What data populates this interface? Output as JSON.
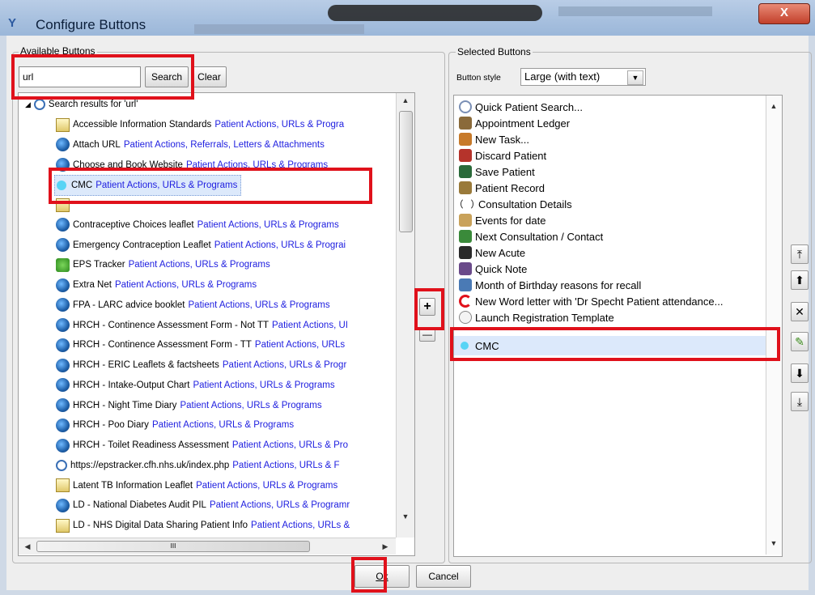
{
  "window": {
    "title": "Configure Buttons",
    "close_label": "X"
  },
  "available": {
    "group_label": "Available Buttons",
    "search_value": "url",
    "search_button": "Search",
    "clear_button": "Clear",
    "root_label": "Search results for 'url'",
    "items": [
      {
        "name": "Accessible Information Standards",
        "category": "Patient Actions, URLs & Progra",
        "icon": "document-icon"
      },
      {
        "name": "Attach URL",
        "category": "Patient Actions, Referrals, Letters & Attachments",
        "icon": "globe-icon"
      },
      {
        "name": "Choose and Book Website",
        "category": "Patient Actions, URLs & Programs",
        "icon": "globe-icon"
      },
      {
        "name": "CMC",
        "category": "Patient Actions, URLs & Programs",
        "icon": "cyan-dot-icon"
      },
      {
        "name": "",
        "category": "",
        "icon": "document-icon"
      },
      {
        "name": "Contraceptive Choices leaflet",
        "category": "Patient Actions, URLs & Programs",
        "icon": "globe-icon"
      },
      {
        "name": "Emergency Contraception Leaflet",
        "category": "Patient Actions, URLs & Prograi",
        "icon": "globe-icon"
      },
      {
        "name": "EPS Tracker",
        "category": "Patient Actions, URLs & Programs",
        "icon": "green-tree-icon"
      },
      {
        "name": "Extra Net",
        "category": "Patient Actions, URLs & Programs",
        "icon": "globe-icon"
      },
      {
        "name": "FPA - LARC advice booklet",
        "category": "Patient Actions, URLs & Programs",
        "icon": "globe-icon"
      },
      {
        "name": "HRCH - Continence Assessment Form - Not TT",
        "category": "Patient Actions, UI",
        "icon": "globe-icon"
      },
      {
        "name": "HRCH - Continence Assessment Form - TT",
        "category": "Patient Actions, URLs",
        "icon": "globe-icon"
      },
      {
        "name": "HRCH - ERIC Leaflets & factsheets",
        "category": "Patient Actions, URLs & Progr",
        "icon": "globe-icon"
      },
      {
        "name": "HRCH - Intake-Output Chart",
        "category": "Patient Actions, URLs & Programs",
        "icon": "globe-icon"
      },
      {
        "name": "HRCH - Night Time Diary",
        "category": "Patient Actions, URLs & Programs",
        "icon": "globe-icon"
      },
      {
        "name": "HRCH - Poo Diary",
        "category": "Patient Actions, URLs & Programs",
        "icon": "globe-icon"
      },
      {
        "name": "HRCH - Toilet Readiness Assessment",
        "category": "Patient Actions, URLs & Pro",
        "icon": "globe-icon"
      },
      {
        "name": "https://epstracker.cfh.nhs.uk/index.php",
        "category": "Patient Actions, URLs & F",
        "icon": "magnifier-icon"
      },
      {
        "name": "Latent TB Information Leaflet",
        "category": "Patient Actions, URLs & Programs",
        "icon": "document-icon"
      },
      {
        "name": "LD - National Diabetes Audit PIL",
        "category": "Patient Actions, URLs & Programr",
        "icon": "globe-icon"
      },
      {
        "name": "LD - NHS Digital Data Sharing Patient Info",
        "category": "Patient Actions, URLs &",
        "icon": "folder-icon"
      }
    ],
    "hscroll_grip": "III"
  },
  "transfer": {
    "add_label": "+",
    "remove_label": "—"
  },
  "selected": {
    "group_label": "Selected Buttons",
    "style_label": "Button style",
    "style_value": "Large (with text)",
    "items": [
      {
        "label": "Quick Patient Search...",
        "icon": "magnifier-icon",
        "color": "#7a8fb5"
      },
      {
        "label": "Appointment Ledger",
        "icon": "ledger-icon",
        "color": "#8a6a3a"
      },
      {
        "label": "New Task...",
        "icon": "task-icon",
        "color": "#c77a2a"
      },
      {
        "label": "Discard Patient",
        "icon": "discard-icon",
        "color": "#b5332b"
      },
      {
        "label": "Save Patient",
        "icon": "save-icon",
        "color": "#2a6a3a"
      },
      {
        "label": "Patient Record",
        "icon": "record-icon",
        "color": "#9a7a3a"
      },
      {
        "label": "Consultation Details",
        "icon": "bracket-icon",
        "color": "#ffffff"
      },
      {
        "label": "Events for date",
        "icon": "events-icon",
        "color": "#c9a25a"
      },
      {
        "label": "Next Consultation / Contact",
        "icon": "next-icon",
        "color": "#3a8a3a"
      },
      {
        "label": "New Acute",
        "icon": "acute-icon",
        "color": "#2a2a2a"
      },
      {
        "label": "Quick Note",
        "icon": "note-icon",
        "color": "#6a4a8a"
      },
      {
        "label": "Month of Birthday reasons for recall",
        "icon": "recall-icon",
        "color": "#4a7ab5"
      },
      {
        "label": "New Word letter with 'Dr Specht Patient attendance...",
        "icon": "letter-c-icon",
        "color": "#e0111b"
      },
      {
        "label": "Launch Registration Template",
        "icon": "template-icon",
        "color": "#cfcfcf"
      },
      {
        "label": "CMC",
        "icon": "cyan-dot-icon",
        "color": "#58d4f5"
      }
    ]
  },
  "side_buttons": [
    {
      "name": "move-top-button",
      "glyph": "⤒"
    },
    {
      "name": "move-up-button",
      "glyph": "⬆"
    },
    {
      "name": "delete-button",
      "glyph": "✕"
    },
    {
      "name": "edit-button",
      "glyph": "✎"
    },
    {
      "name": "move-down-button",
      "glyph": "⬇"
    },
    {
      "name": "move-bottom-button",
      "glyph": "⤓"
    }
  ],
  "footer": {
    "ok_label": "Ok",
    "cancel_label": "Cancel"
  }
}
